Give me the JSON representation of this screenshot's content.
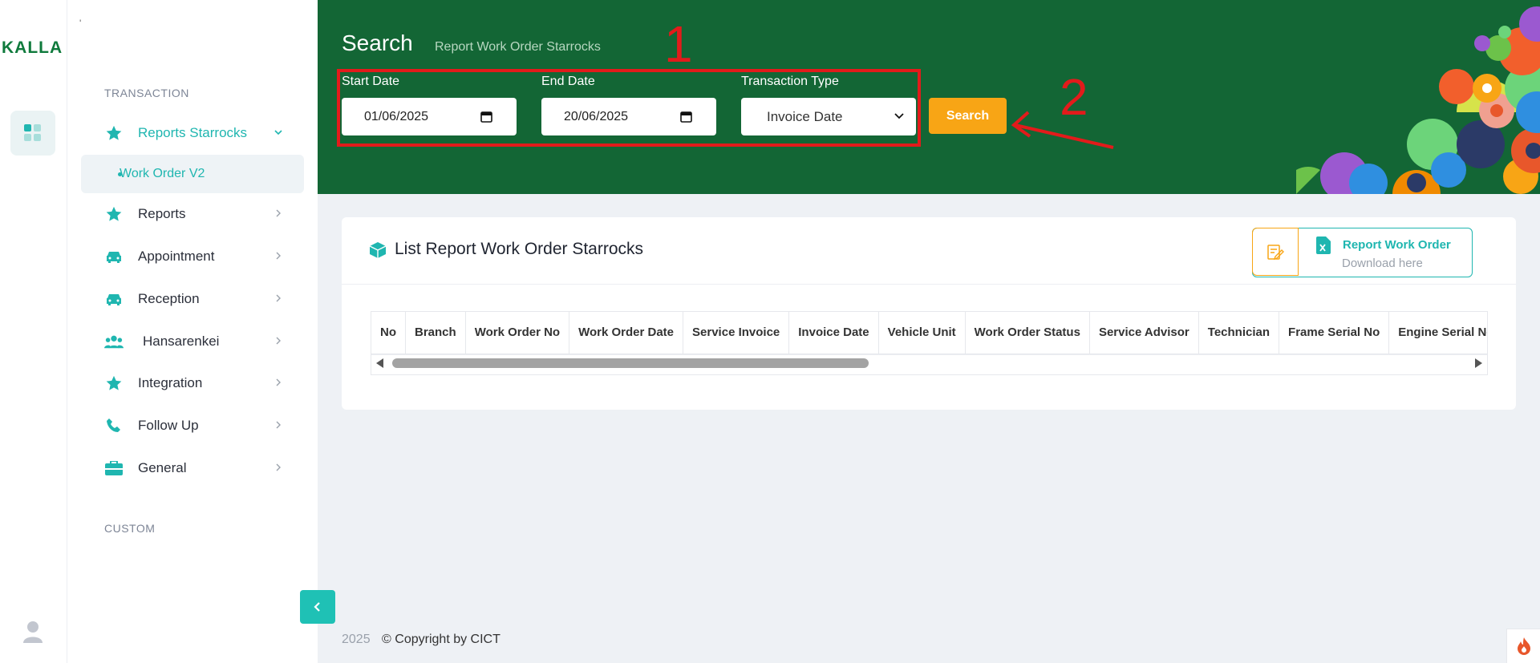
{
  "logo": {
    "text": "KALLA"
  },
  "sidebar": {
    "tick": "'",
    "section_transaction": "TRANSACTION",
    "section_custom": "CUSTOM",
    "items": [
      {
        "label": "Reports Starrocks",
        "icon": "star-icon",
        "active": true,
        "expanded": true
      },
      {
        "label": "Reports",
        "icon": "star-icon"
      },
      {
        "label": "Appointment",
        "icon": "car-icon"
      },
      {
        "label": "Reception",
        "icon": "car-icon"
      },
      {
        "label": "Hansarenkei",
        "icon": "users-icon"
      },
      {
        "label": "Integration",
        "icon": "star-icon"
      },
      {
        "label": "Follow Up",
        "icon": "phone-icon"
      },
      {
        "label": "General",
        "icon": "briefcase-icon"
      }
    ],
    "sub_item": "Work Order V2"
  },
  "header": {
    "title": "Search",
    "subtitle": "Report Work Order Starrocks",
    "start_label": "Start Date",
    "start_value": "01/06/2025",
    "end_label": "End Date",
    "end_value": "20/06/2025",
    "type_label": "Transaction Type",
    "type_value": "Invoice Date",
    "search_button": "Search",
    "annotation_1": "1",
    "annotation_2": "2"
  },
  "card": {
    "title": "List Report Work Order Starrocks",
    "report_title": "Report Work Order",
    "report_sub": "Download here",
    "columns": [
      "No",
      "Branch",
      "Work Order No",
      "Work Order Date",
      "Service Invoice",
      "Invoice Date",
      "Vehicle Unit",
      "Work Order Status",
      "Service Advisor",
      "Technician",
      "Frame Serial No",
      "Engine Serial No"
    ]
  },
  "footer": {
    "year": "2025",
    "copyright": "© Copyright by CICT"
  },
  "colors": {
    "brand_green": "#136635",
    "accent_teal": "#1fb6b0",
    "accent_orange": "#f8a515",
    "annotation_red": "#e21b1b"
  }
}
